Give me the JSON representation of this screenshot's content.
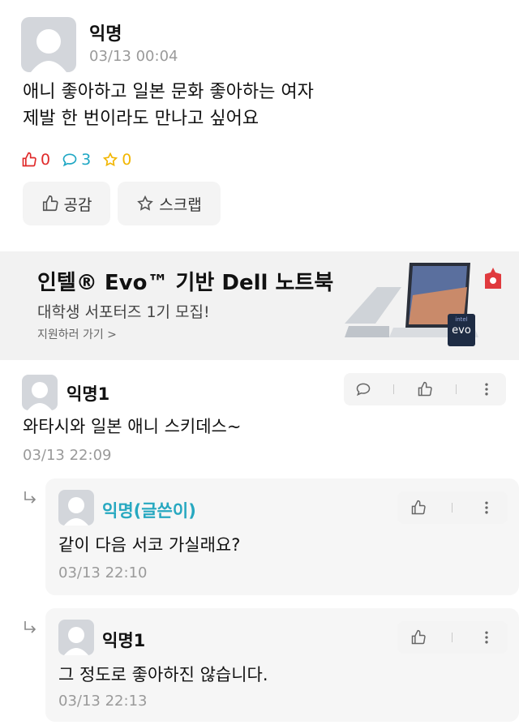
{
  "post": {
    "author": "익명",
    "time": "03/13 00:04",
    "body_lines": [
      "애니 좋아하고 일본 문화 좋아하는 여자",
      "제발 한 번이라도 만나고 싶어요"
    ],
    "likes": "0",
    "comments": "3",
    "scraps": "0",
    "like_button": "공감",
    "scrap_button": "스크랩"
  },
  "ad": {
    "title": "인텔® Evo™ 기반 Dell 노트북",
    "subtitle": "대학생 서포터즈 1기 모집!",
    "link": "지원하러 가기 >",
    "badge_brand": "intel",
    "badge_text": "evo"
  },
  "comments": [
    {
      "author": "익명1",
      "text": "와타시와 일본 애니 스키데스~",
      "time": "03/13 22:09"
    }
  ],
  "replies": [
    {
      "author": "익명(글쓴이)",
      "text": "같이 다음 서코 가실래요?",
      "time": "03/13 22:10",
      "is_op": true
    },
    {
      "author": "익명1",
      "text": "그 정도로 좋아하진 않습니다.",
      "time": "03/13 22:13",
      "is_op": false
    }
  ],
  "colors": {
    "like": "#e02a2a",
    "comment": "#1fa7c4",
    "scrap": "#f2b600",
    "op_name": "#27a8c0"
  },
  "icons": [
    "thumbs-up-icon",
    "speech-bubble-icon",
    "star-icon",
    "more-vertical-icon",
    "reply-arrow-icon",
    "avatar-placeholder"
  ]
}
